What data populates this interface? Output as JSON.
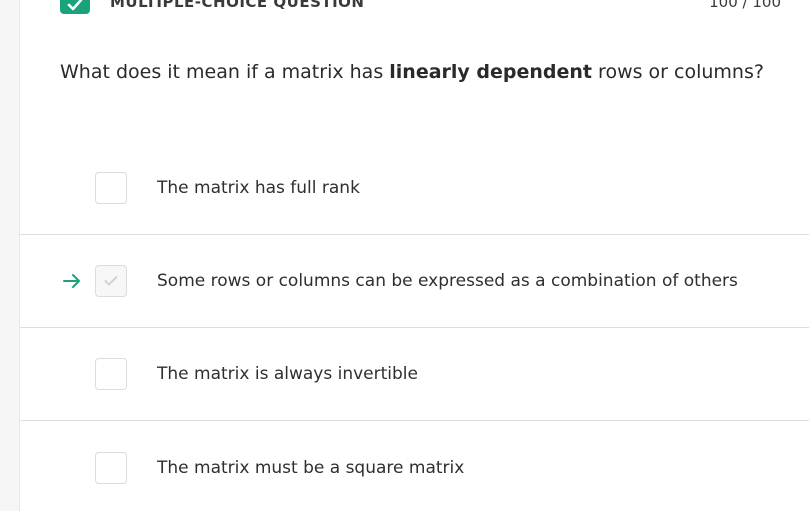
{
  "header": {
    "badge_icon": "checkmark-icon",
    "question_type": "MULTIPLE-CHOICE QUESTION",
    "score": "100 / 100",
    "accent_color": "#1aa37a"
  },
  "question": {
    "prefix": "What does it mean if a matrix has ",
    "emphasis": "linearly dependent",
    "suffix": " rows or columns?"
  },
  "options": [
    {
      "label": "The matrix has full rank",
      "checked": false,
      "indicator": ""
    },
    {
      "label": "Some rows or columns can be expressed as a combination of others",
      "checked": true,
      "indicator": "arrow-right-icon"
    },
    {
      "label": "The matrix is always invertible",
      "checked": false,
      "indicator": ""
    },
    {
      "label": "The matrix must be a square matrix",
      "checked": false,
      "indicator": ""
    }
  ]
}
